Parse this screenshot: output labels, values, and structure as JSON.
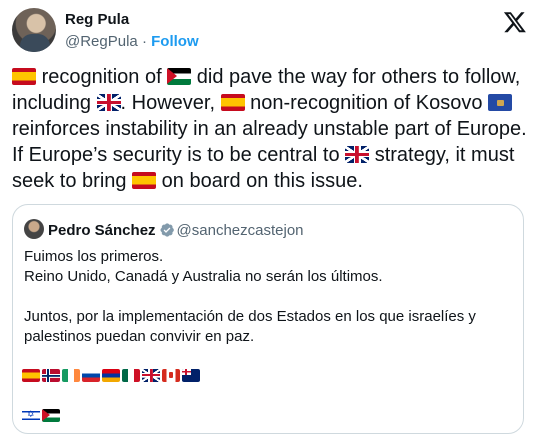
{
  "author": {
    "name": "Reg Pula",
    "handle": "@RegPula",
    "separator": " · ",
    "follow_label": "Follow"
  },
  "tweet": {
    "segments": [
      "recognition of",
      "did pave the way for others to follow, including",
      ". However,",
      "non-recognition of Kosovo",
      "reinforces instability in an already unstable part of Europe. If Europe’s security is to be central to",
      "strategy, it must seek to bring",
      "on board on this issue."
    ]
  },
  "quoted": {
    "name": "Pedro Sánchez",
    "handle": "@sanchezcastejon",
    "text": "Fuimos los primeros.\nReino Unido, Canadá y Australia no serán los últimos.\n\nJuntos, por la implementación de dos Estados en los que israelíes y palestinos puedan convivir en paz.",
    "flags_row1": [
      "flag-spain",
      "flag-norway",
      "flag-ireland",
      "flag-slovenia",
      "flag-armenia",
      "flag-mexico",
      "flag-uk",
      "flag-canada",
      "flag-australia"
    ],
    "flags_row2": [
      "flag-israel",
      "flag-palestine"
    ]
  },
  "colors": {
    "follow": "#1d9bf0",
    "secondary_text": "#536471",
    "border": "#cfd9de",
    "verified": "#829aab"
  }
}
